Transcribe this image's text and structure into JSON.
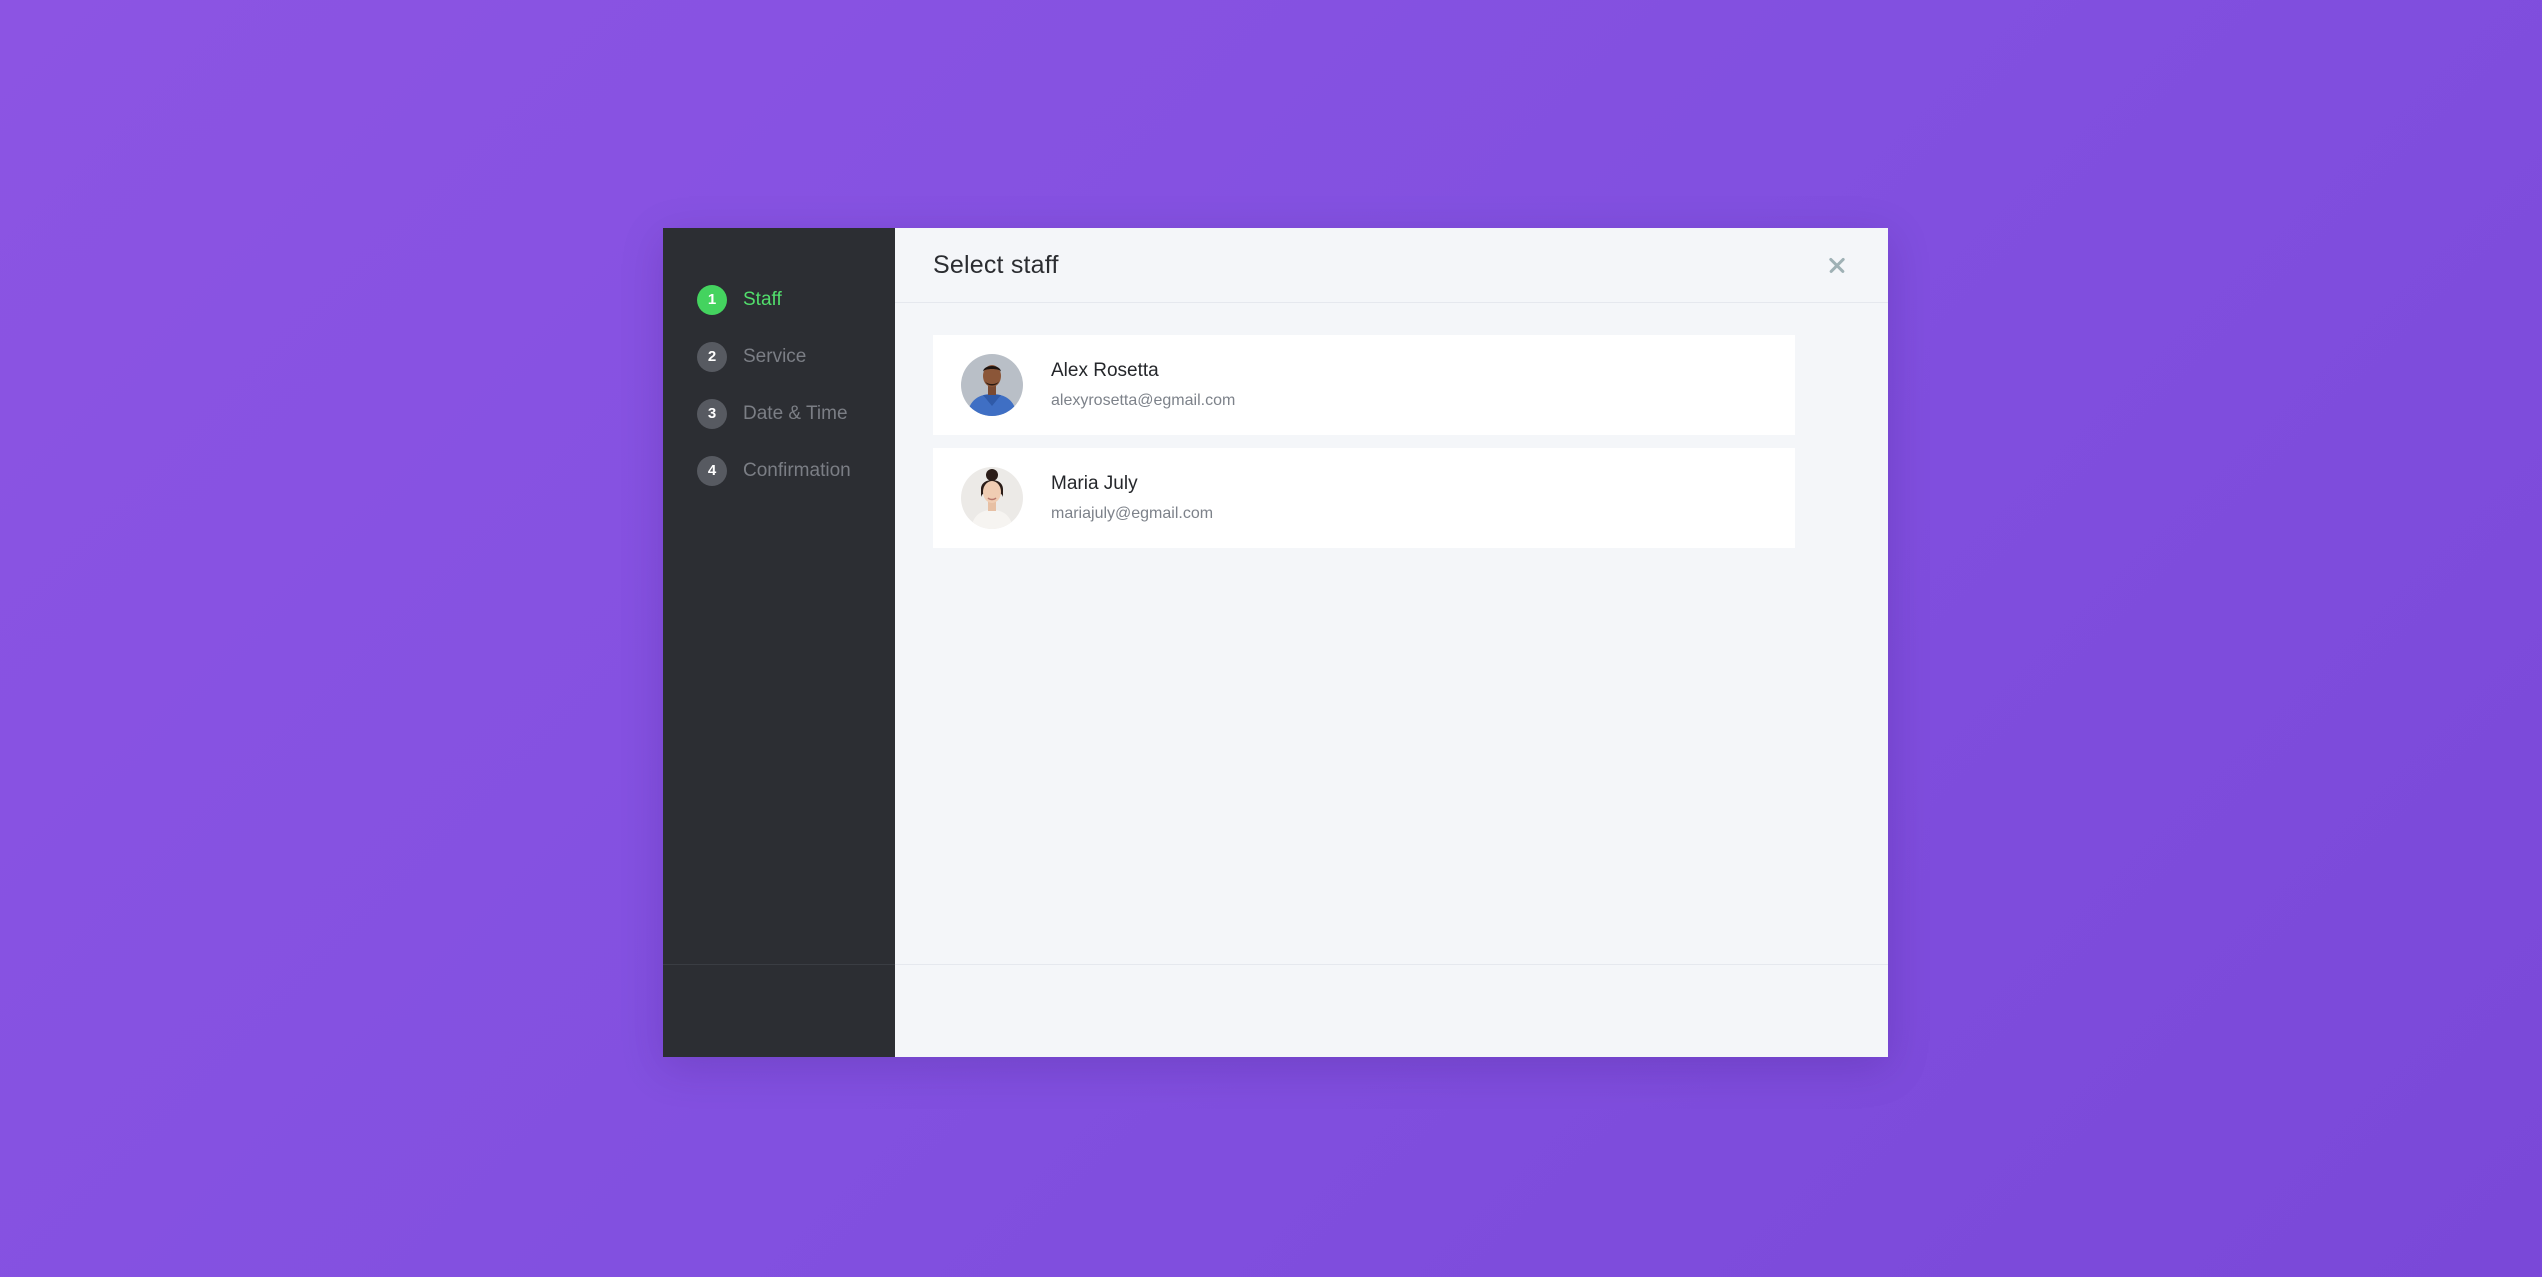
{
  "steps": [
    {
      "number": "1",
      "label": "Staff",
      "active": true
    },
    {
      "number": "2",
      "label": "Service",
      "active": false
    },
    {
      "number": "3",
      "label": "Date & Time",
      "active": false
    },
    {
      "number": "4",
      "label": "Confirmation",
      "active": false
    }
  ],
  "header": {
    "title": "Select staff",
    "close_icon": "close-icon"
  },
  "staff": [
    {
      "name": "Alex Rosetta",
      "email": "alexyrosetta@egmail.com",
      "avatar": "avatar-photo"
    },
    {
      "name": "Maria July",
      "email": "mariajuly@egmail.com",
      "avatar": "avatar-photo"
    }
  ],
  "colors": {
    "background": "#8652e0",
    "sidebar": "#2c2e33",
    "active_step": "#44d35f",
    "content_bg": "#f4f6f9"
  }
}
